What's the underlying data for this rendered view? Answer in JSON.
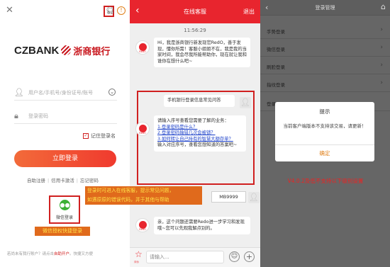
{
  "login": {
    "close_icon": "close-icon",
    "logo_en": "CZBANK",
    "logo_cn": "浙商银行",
    "account_placeholder": "用户名/手机号/身份证号/账号",
    "password_placeholder": "登录密码",
    "remember_label": "记住登录名",
    "login_button": "立即登录",
    "links": [
      "自助注册",
      "信用卡激活",
      "忘记密码"
    ],
    "wechat_label": "微信登录",
    "wechat_note": "微信授权快捷登录",
    "bottom_text": "若尚未有我行账户？请点击",
    "bottom_link": "自助开户",
    "bottom_suffix": "。快捷又方便"
  },
  "chat": {
    "title": "在线客服",
    "exit": "退出",
    "time": "11:56:29",
    "bot_name": "RedO",
    "greeting": "Hi，我是浙商银行新发现官RedO，善于发现，懂你所需！客服小姐姐不在，我是我的当家时间，我会尽我所能帮助你，现在就让我和谁你在想什么吧~",
    "user_message": "手机银行登录信息常见问答",
    "menu_intro": "请输入序号查看您需要了解的业务：",
    "menu_items": [
      "1.登录密码是什么？",
      "2.登录密码输错几次会被锁？",
      "3.如何转让自己持有的智慧大额存单？"
    ],
    "menu_footer": "输入对应序号，查看您想知道的答案吧~",
    "mb_reply": "MB9999",
    "study_msg": "亲，这个问题还需要Redo进一步学习和发现哦~您可以先观我解点别的。",
    "input_placeholder": "请输入...",
    "star_label": "评价",
    "note_line1": "登录时可进入在线客服，提示常见问题，",
    "note_line2": "如遇原原的错误代码，并于其他与帮助"
  },
  "manage": {
    "title": "登录管理",
    "rows": [
      "手势登录",
      "微信登录",
      "刷脸登录",
      "指纹登录",
      "登录"
    ],
    "dialog_title": "提示",
    "dialog_msg": "当前客户端版本不支持该交易，请更新！",
    "dialog_ok": "确定",
    "version_note": "V4.0.2及低不支持以下级别设置"
  }
}
